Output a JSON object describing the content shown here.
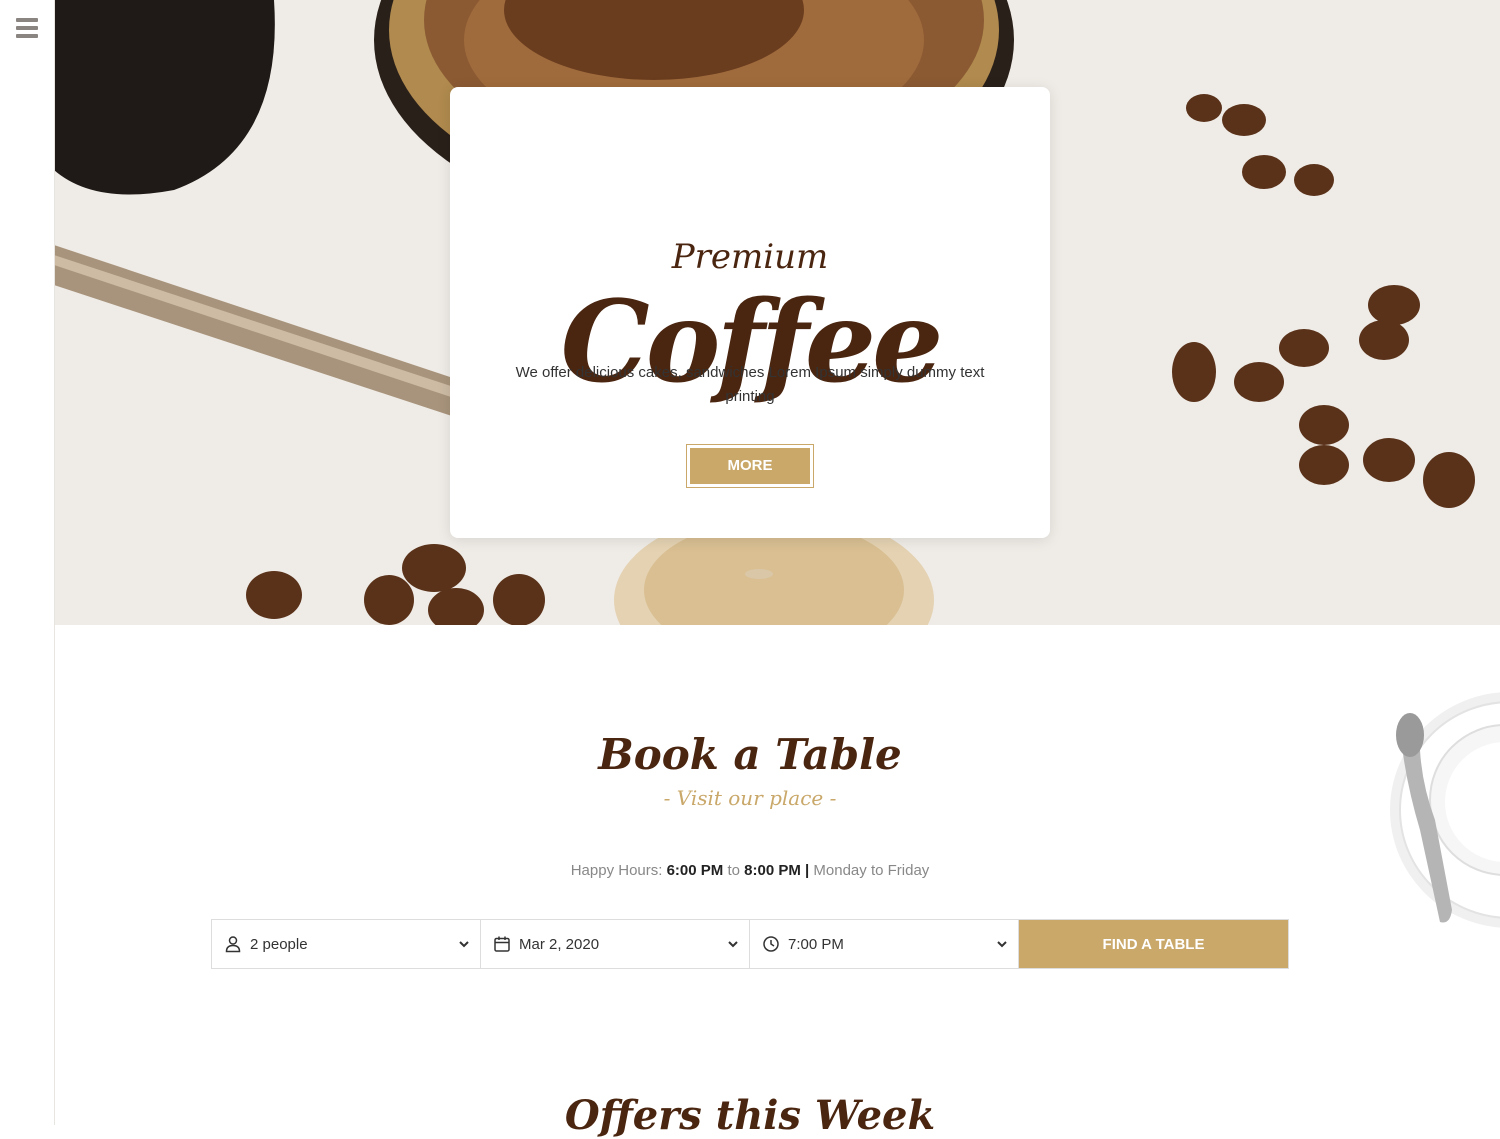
{
  "sidebar": {
    "menu_icon": "hamburger-icon"
  },
  "hero": {
    "subtitle": "Premium",
    "title": "Coffee",
    "description": "We offer delicious cakes, sandwiches Lorem Ipsum simply dummy text printing",
    "more_label": "MORE"
  },
  "booking": {
    "title": "Book a Table",
    "subtitle": "- Visit our place -",
    "hours_label": "Happy Hours:",
    "hours_start": "6:00 PM",
    "hours_to": "to",
    "hours_end": "8:00 PM",
    "hours_sep": "|",
    "hours_days": "Monday to Friday",
    "people": "2 people",
    "date": "Mar 2, 2020",
    "time": "7:00 PM",
    "find_label": "FIND A TABLE"
  },
  "offers": {
    "title": "Offers this Week"
  },
  "colors": {
    "accent": "#c9a86a",
    "brand_brown": "#4a2510",
    "hero_bg": "#efebe6"
  }
}
